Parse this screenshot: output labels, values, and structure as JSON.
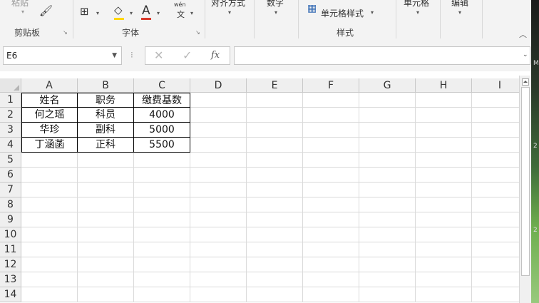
{
  "ribbon": {
    "paste_label": "粘贴",
    "clipboard_group": "剪贴板",
    "font_group": "字体",
    "align_label": "对齐方式",
    "number_label": "数字",
    "cell_style_label": "单元格样式",
    "styles_group": "样式",
    "cells_label": "单元格",
    "edit_label": "编辑",
    "wen_top": "wén",
    "wen_bottom": "文",
    "font_color_letter": "A"
  },
  "formula_bar": {
    "name_box": "E6",
    "fx_label": "fx",
    "formula_value": ""
  },
  "columns": [
    "A",
    "B",
    "C",
    "D",
    "E",
    "F",
    "G",
    "H",
    "I"
  ],
  "rows": [
    "1",
    "2",
    "3",
    "4",
    "5",
    "6",
    "7",
    "8",
    "9",
    "10",
    "11",
    "12",
    "13",
    "14"
  ],
  "table": {
    "header": [
      "姓名",
      "职务",
      "缴费基数"
    ],
    "data": [
      [
        "何之瑶",
        "科员",
        "4000"
      ],
      [
        "华珍",
        "副科",
        "5000"
      ],
      [
        "丁涵菡",
        "正科",
        "5500"
      ]
    ]
  },
  "background_strip_chars": [
    "M",
    "2",
    "2"
  ],
  "colors": {
    "accent_font_color": "#d83b2d",
    "accent_fill": "#ffd700"
  }
}
